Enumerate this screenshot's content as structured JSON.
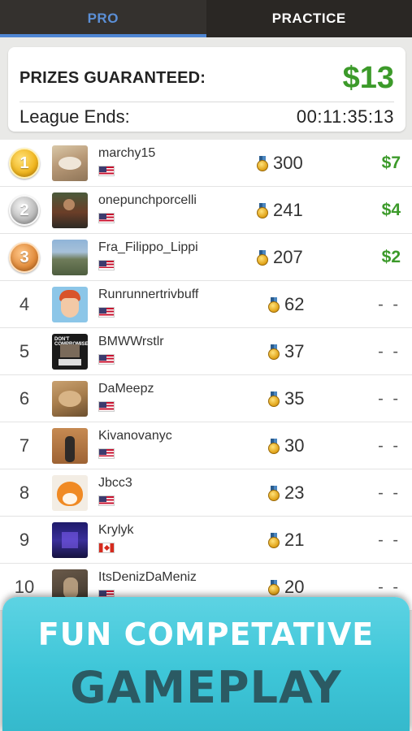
{
  "tabs": [
    {
      "label": "PRO",
      "active": true
    },
    {
      "label": "PRACTICE",
      "active": false
    }
  ],
  "prize_card": {
    "label": "PRIZES GUARANTEED:",
    "amount": "$13",
    "league_label": "League Ends:",
    "league_time": "00:11:35:13"
  },
  "colors": {
    "accent_blue": "#4f86d3",
    "money_green": "#3c9a2a",
    "banner_cyan": "#3ec6d8"
  },
  "leaderboard": [
    {
      "rank": "1",
      "medal": "gold",
      "username": "marchy15",
      "country": "us",
      "points": "300",
      "prize": "$7"
    },
    {
      "rank": "2",
      "medal": "silver",
      "username": "onepunchporcelli",
      "country": "us",
      "points": "241",
      "prize": "$4"
    },
    {
      "rank": "3",
      "medal": "bronze",
      "username": "Fra_Filippo_Lippi",
      "country": "us",
      "points": "207",
      "prize": "$2"
    },
    {
      "rank": "4",
      "username": "Runrunnertrivbuff",
      "country": "us",
      "points": "62",
      "prize": "- -"
    },
    {
      "rank": "5",
      "username": "BMWWrstlr",
      "country": "us",
      "points": "37",
      "prize": "- -",
      "avatar_text": [
        "DON'T COMPROMISE",
        "NOTARIZE"
      ]
    },
    {
      "rank": "6",
      "username": "DaMeepz",
      "country": "us",
      "points": "35",
      "prize": "- -"
    },
    {
      "rank": "7",
      "username": "Kivanovanyc",
      "country": "us",
      "points": "30",
      "prize": "- -"
    },
    {
      "rank": "8",
      "username": "Jbcc3",
      "country": "us",
      "points": "23",
      "prize": "- -"
    },
    {
      "rank": "9",
      "username": "Krylyk",
      "country": "ca",
      "points": "21",
      "prize": "- -"
    },
    {
      "rank": "10",
      "username": "ItsDenizDaMeniz",
      "country": "us",
      "points": "20",
      "prize": "- -"
    }
  ],
  "banner": {
    "line1": "FUN COMPETATIVE",
    "line2": "GAMEPLAY"
  }
}
